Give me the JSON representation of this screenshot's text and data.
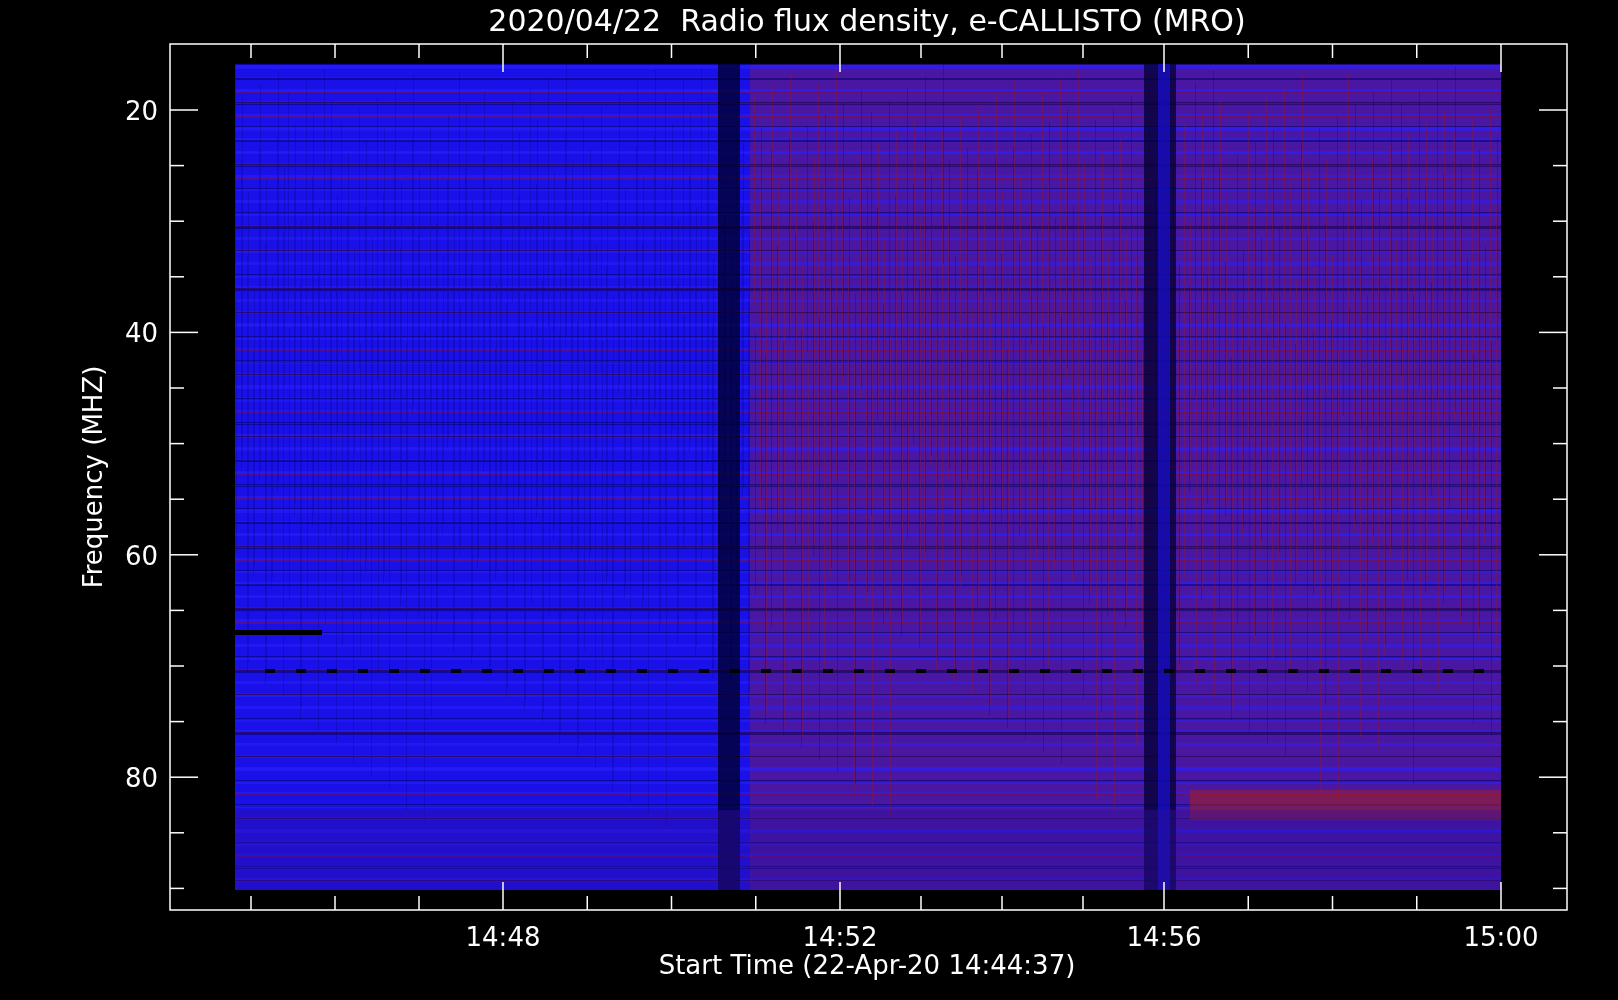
{
  "title": "2020/04/22  Radio flux density, e-CALLISTO (MRO)",
  "y_axis": {
    "label": "Frequency (MHZ)",
    "ticks": [
      "20",
      "40",
      "60",
      "80"
    ]
  },
  "x_axis": {
    "label": "Start Time (22-Apr-20 14:44:37)",
    "ticks": [
      "14:48",
      "14:52",
      "14:56",
      "15:00"
    ]
  }
}
